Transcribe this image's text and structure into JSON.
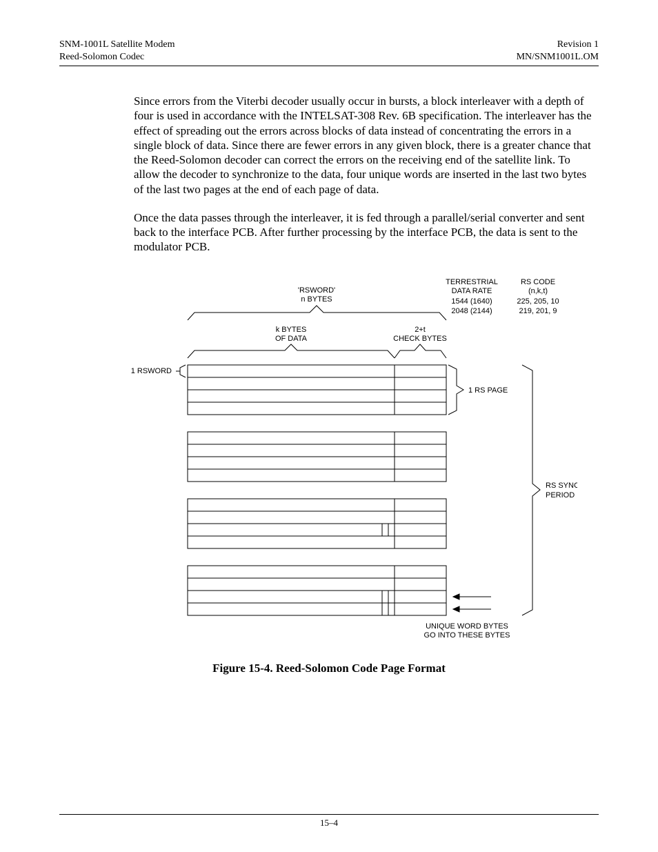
{
  "header": {
    "topLeft": "SNM-1001L Satellite Modem",
    "bottomLeft": "Reed-Solomon Codec",
    "topRight": "Revision 1",
    "bottomRight": "MN/SNM1001L.OM"
  },
  "paragraphs": {
    "p1": "Since errors from the Viterbi decoder usually occur in bursts, a block interleaver with a depth of four is used in accordance with the INTELSAT-308 Rev. 6B specification. The interleaver has the effect of spreading out the errors across blocks of data instead of concentrating the errors in a single block of data. Since there are fewer errors in any given block, there is a greater chance that the Reed-Solomon decoder can correct the errors on the receiving end of the satellite link. To allow the decoder to synchronize to the data, four unique words are inserted in the last two bytes of the last two pages at the end of each page of data.",
    "p2": "Once the data passes through the interleaver, it is fed through a parallel/serial converter and sent back to the interface PCB. After further processing by the interface PCB, the data is sent to the modulator PCB."
  },
  "figure": {
    "caption": "Figure 15-4. Reed-Solomon Code Page Format",
    "labels": {
      "rsword_top1": "'RSWORD'",
      "rsword_top2": "n BYTES",
      "kbytes1": "k BYTES",
      "kbytes2": "OF DATA",
      "check1": "2+t",
      "check2": "CHECK BYTES",
      "one_rsword": "1 RSWORD",
      "one_rs_page": "1 RS PAGE",
      "rs_synch1": "RS SYNCH",
      "rs_synch2": "PERIOD",
      "terr1": "TERRESTRIAL",
      "terr2": "DATA RATE",
      "terr_row1": "1544 (1640)",
      "terr_row2": "2048 (2144)",
      "rscode1": "RS CODE",
      "rscode2": "(n,k,t)",
      "rscode_row1": "225,  205,  10",
      "rscode_row2": "219,  201,   9",
      "unique1": "UNIQUE WORD BYTES",
      "unique2": "GO INTO THESE BYTES"
    }
  },
  "pageNumber": "15–4"
}
